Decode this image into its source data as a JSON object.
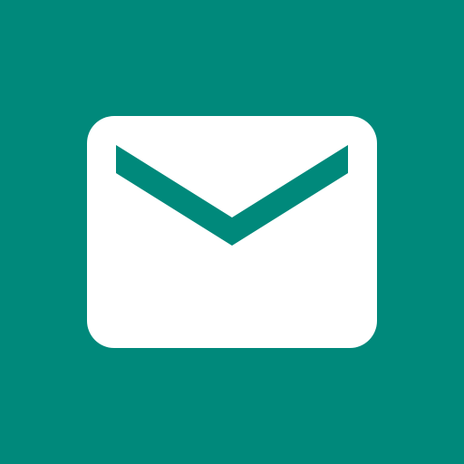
{
  "icon": {
    "name": "mail-icon",
    "background_color": "#00897B",
    "envelope_color": "#FFFFFF",
    "flap_color": "#00897B"
  }
}
